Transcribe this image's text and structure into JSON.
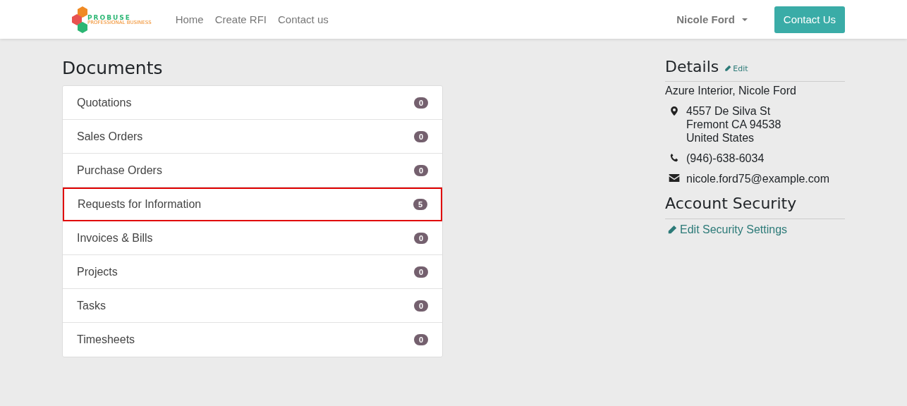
{
  "navbar": {
    "logo": {
      "name": "PROBUSE",
      "tagline": "PROFESSIONAL BUSINESS"
    },
    "links": [
      "Home",
      "Create RFI",
      "Contact us"
    ],
    "user": "Nicole Ford",
    "button": "Contact Us"
  },
  "documents": {
    "title": "Documents",
    "items": [
      {
        "label": "Quotations",
        "count": "0",
        "highlighted": false
      },
      {
        "label": "Sales Orders",
        "count": "0",
        "highlighted": false
      },
      {
        "label": "Purchase Orders",
        "count": "0",
        "highlighted": false
      },
      {
        "label": "Requests for Information",
        "count": "5",
        "highlighted": true
      },
      {
        "label": "Invoices & Bills",
        "count": "0",
        "highlighted": false
      },
      {
        "label": "Projects",
        "count": "0",
        "highlighted": false
      },
      {
        "label": "Tasks",
        "count": "0",
        "highlighted": false
      },
      {
        "label": "Timesheets",
        "count": "0",
        "highlighted": false
      }
    ]
  },
  "details": {
    "title": "Details",
    "edit": "Edit",
    "name": "Azure Interior, Nicole Ford",
    "contacts": [
      {
        "kind": "address",
        "lines": [
          "4557 De Silva St",
          "Fremont CA 94538",
          "United States"
        ]
      },
      {
        "kind": "phone",
        "lines": [
          "(946)-638-6034"
        ]
      },
      {
        "kind": "email",
        "lines": [
          "nicole.ford75@example.com"
        ]
      }
    ]
  },
  "security": {
    "title": "Account Security",
    "link": "Edit Security Settings"
  }
}
